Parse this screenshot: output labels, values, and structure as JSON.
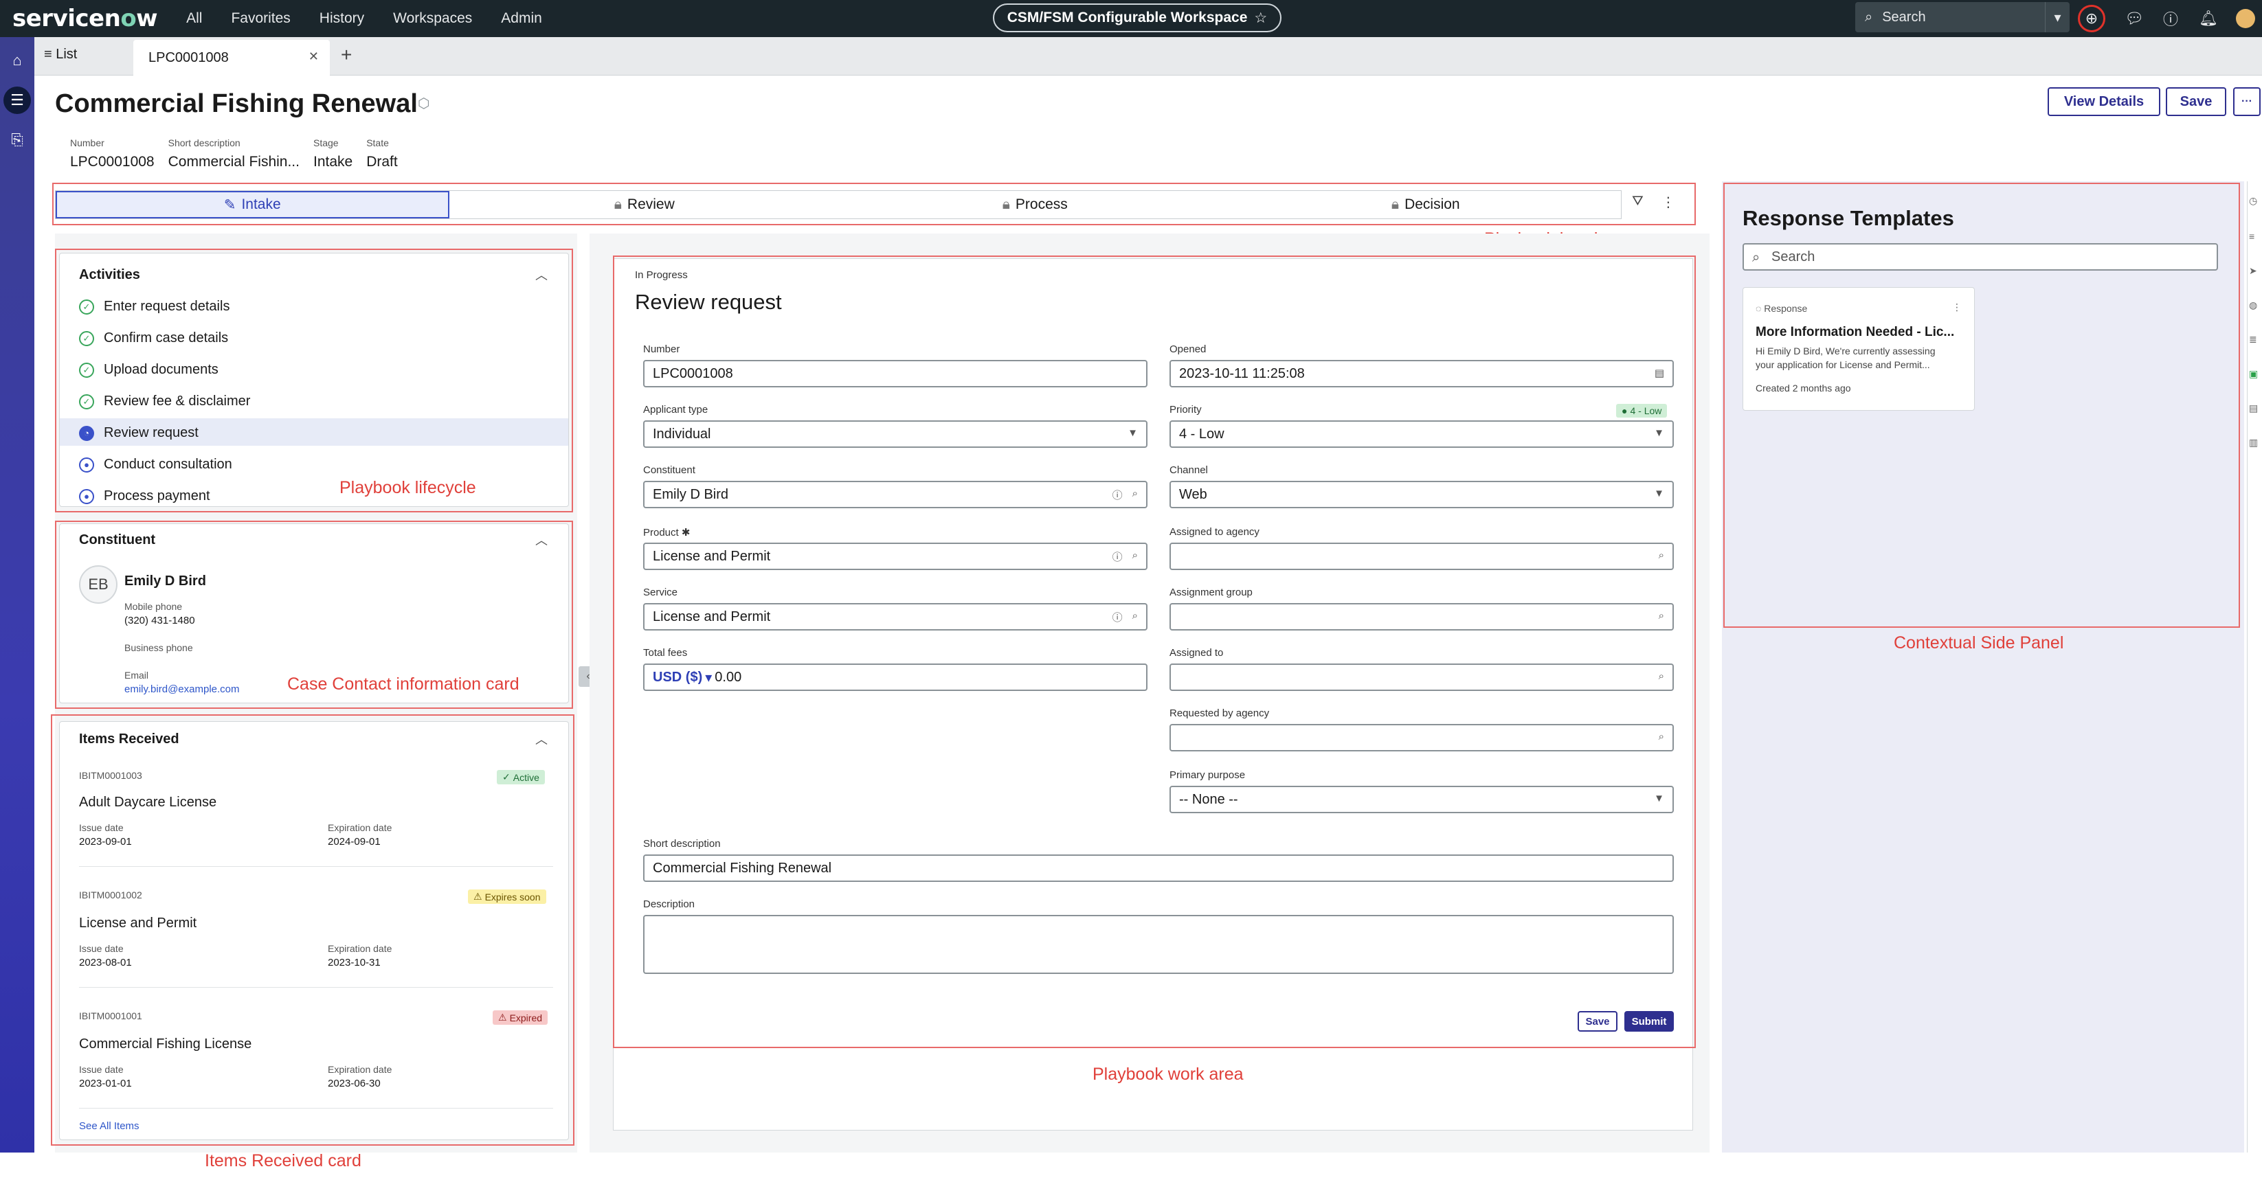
{
  "nav": {
    "logo_main": "servicen",
    "logo_accent": "o",
    "logo_tail": "w",
    "links": [
      "All",
      "Favorites",
      "History",
      "Workspaces",
      "Admin"
    ],
    "workspace": "CSM/FSM Configurable Workspace",
    "search_placeholder": "Search"
  },
  "tabs": {
    "list": "≡ List",
    "active": "LPC0001008"
  },
  "header": {
    "title": "Commercial Fishing Renewal",
    "view_details": "View Details",
    "save": "Save",
    "more": "···",
    "meta": [
      {
        "label": "Number",
        "value": "LPC0001008"
      },
      {
        "label": "Short description",
        "value": "Commercial Fishin..."
      },
      {
        "label": "Stage",
        "value": "Intake"
      },
      {
        "label": "State",
        "value": "Draft"
      }
    ]
  },
  "stages": [
    "Intake",
    "Review",
    "Process",
    "Decision"
  ],
  "labels": {
    "playbook_header": "Playbook header",
    "playbook_lifecycle": "Playbook lifecycle",
    "contact_card": "Case Contact information card",
    "items_card": "Items Received card",
    "work_area": "Playbook work area",
    "side_panel": "Contextual Side Panel"
  },
  "activities": {
    "title": "Activities",
    "items": [
      {
        "label": "Enter request details",
        "state": "done"
      },
      {
        "label": "Confirm case details",
        "state": "done"
      },
      {
        "label": "Upload documents",
        "state": "done"
      },
      {
        "label": "Review fee & disclaimer",
        "state": "done"
      },
      {
        "label": "Review request",
        "state": "current"
      },
      {
        "label": "Conduct consultation",
        "state": "todo"
      },
      {
        "label": "Process payment",
        "state": "todo"
      }
    ]
  },
  "constituent": {
    "title": "Constituent",
    "initials": "EB",
    "name": "Emily D Bird",
    "mobile_label": "Mobile phone",
    "mobile": "(320) 431-1480",
    "business_label": "Business phone",
    "email_label": "Email",
    "email": "emily.bird@example.com"
  },
  "items": {
    "title": "Items Received",
    "see_all": "See All Items",
    "issue_label": "Issue date",
    "expiration_label": "Expiration date",
    "list": [
      {
        "id": "IBITM0001003",
        "name": "Adult Daycare License",
        "issue": "2023-09-01",
        "expiration": "2024-09-01",
        "status": "Active"
      },
      {
        "id": "IBITM0001002",
        "name": "License and Permit",
        "issue": "2023-08-01",
        "expiration": "2023-10-31",
        "status": "Expires soon"
      },
      {
        "id": "IBITM0001001",
        "name": "Commercial Fishing License",
        "issue": "2023-01-01",
        "expiration": "2023-06-30",
        "status": "Expired"
      }
    ]
  },
  "work": {
    "state": "In Progress",
    "title": "Review request",
    "fields": {
      "number": {
        "label": "Number",
        "value": "LPC0001008"
      },
      "opened": {
        "label": "Opened",
        "value": "2023-10-11 11:25:08"
      },
      "applicant_type": {
        "label": "Applicant type",
        "value": "Individual"
      },
      "priority": {
        "label": "Priority",
        "value": "4 - Low",
        "badge": "4 - Low"
      },
      "constituent": {
        "label": "Constituent",
        "value": "Emily D Bird"
      },
      "channel": {
        "label": "Channel",
        "value": "Web"
      },
      "product": {
        "label": "Product",
        "value": "License and Permit"
      },
      "assigned_agency": {
        "label": "Assigned to agency",
        "value": ""
      },
      "service": {
        "label": "Service",
        "value": "License and Permit"
      },
      "assignment_group": {
        "label": "Assignment group",
        "value": ""
      },
      "total_fees": {
        "label": "Total fees",
        "currency": "USD ($)",
        "value": "0.00"
      },
      "assigned_to": {
        "label": "Assigned to",
        "value": ""
      },
      "requested_agency": {
        "label": "Requested by agency",
        "value": ""
      },
      "primary_purpose": {
        "label": "Primary purpose",
        "value": "-- None --"
      },
      "short_description": {
        "label": "Short description",
        "value": "Commercial Fishing Renewal"
      },
      "description": {
        "label": "Description",
        "value": ""
      }
    },
    "save": "Save",
    "submit": "Submit"
  },
  "side": {
    "title": "Response Templates",
    "search_placeholder": "Search",
    "card": {
      "type": "Response",
      "title": "More Information Needed - Lic...",
      "body1": "Hi Emily D Bird, We're currently assessing",
      "body2": "your application for License and Permit...",
      "created": "Created 2 months ago"
    }
  },
  "colors": {
    "brand": "#2e2f8f",
    "accent_blue": "#3a51c9",
    "annotation_red": "#e0403a",
    "done_green": "#3aa65c"
  }
}
